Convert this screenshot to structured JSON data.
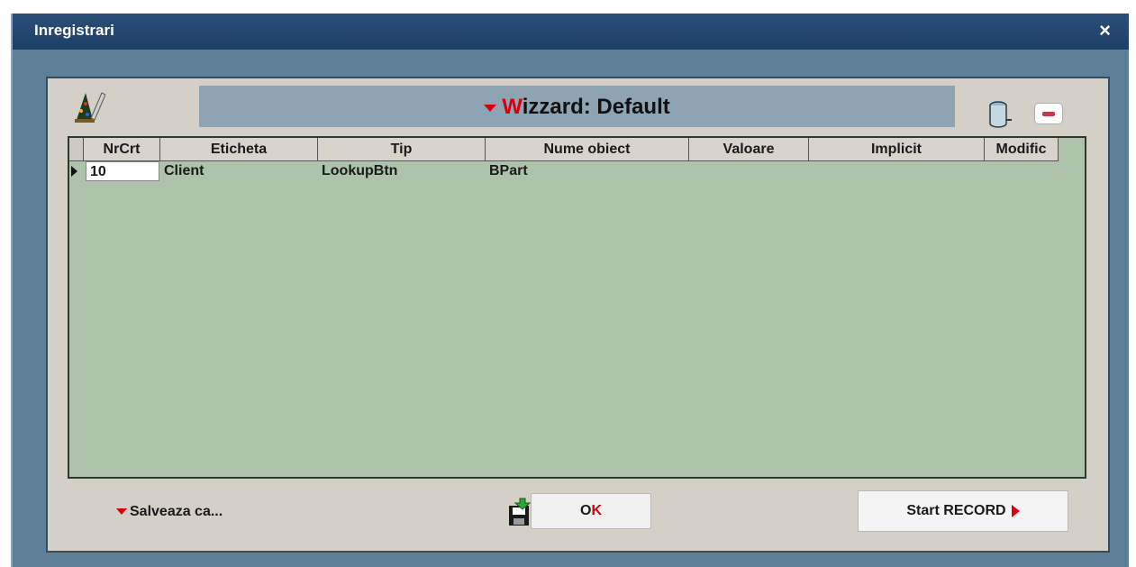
{
  "window": {
    "title": "Inregistrari",
    "close_symbol": "×"
  },
  "wizard": {
    "prefix_letter": "W",
    "rest_title": "izzard: Default"
  },
  "grid": {
    "columns": [
      "NrCrt",
      "Eticheta",
      "Tip",
      "Nume obiect",
      "Valoare",
      "Implicit",
      "Modific"
    ],
    "rows": [
      {
        "nrcrt": "10",
        "eticheta": "Client",
        "tip": "LookupBtn",
        "nume_obiect": "BPart",
        "valoare": "",
        "implicit": "",
        "modific": ""
      }
    ]
  },
  "footer": {
    "save_as_label": "Salveaza ca...",
    "ok_o": "O",
    "ok_k": "K",
    "start_record_label": "Start RECORD"
  },
  "icons": {
    "wizard_icon": "wizard-hat-pencil-icon",
    "database_icon": "database-cylinder-icon",
    "collapse_icon": "minus-icon",
    "save_icon": "floppy-save-icon",
    "dropdown_arrow": "red-triangle-down-icon",
    "play_arrow": "red-triangle-right-icon"
  },
  "colors": {
    "accent_red": "#d8000f",
    "grid_bg": "#adc3aa",
    "title_bar": "#1e3f66"
  }
}
